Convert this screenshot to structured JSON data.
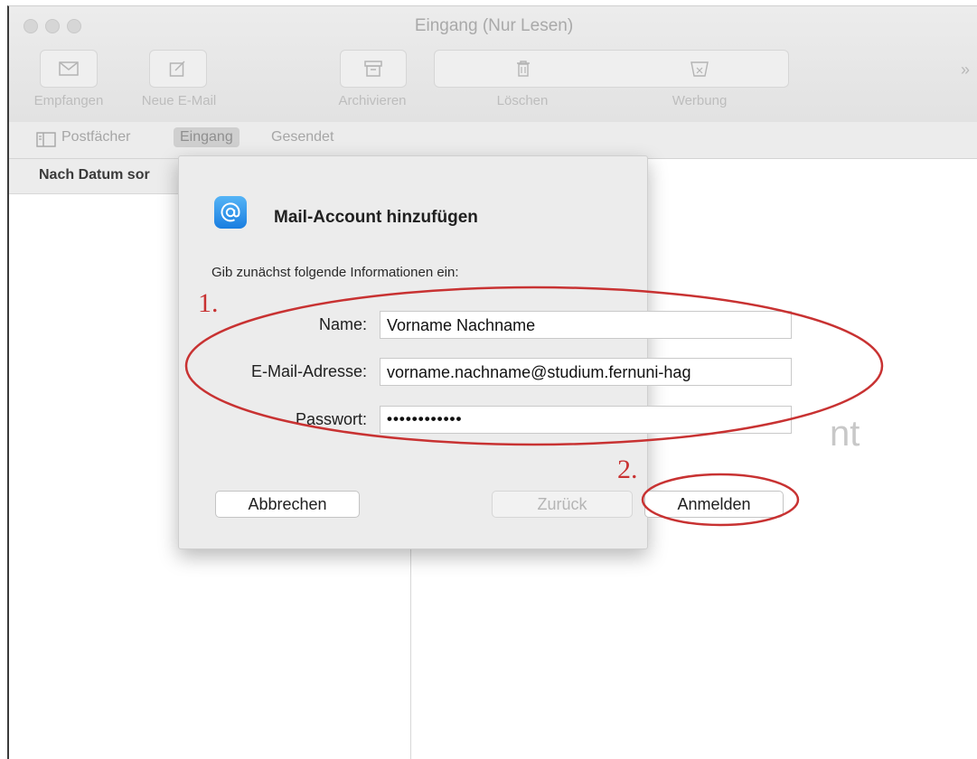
{
  "window": {
    "title": "Eingang (Nur Lesen)"
  },
  "toolbar": {
    "receive_label": "Empfangen",
    "new_mail_label": "Neue E-Mail",
    "archive_label": "Archivieren",
    "delete_label": "Löschen",
    "junk_label": "Werbung",
    "overflow": "»"
  },
  "favorites": {
    "mailboxes": "Postfächer",
    "inbox": "Eingang",
    "sent": "Gesendet"
  },
  "list": {
    "sort_label": "Nach Datum sor"
  },
  "reading": {
    "ghost_text": "nt"
  },
  "dialog": {
    "title": "Mail-Account hinzufügen",
    "subtitle": "Gib zunächst folgende Informationen ein:",
    "name_label": "Name:",
    "name_value": "Vorname Nachname",
    "email_label": "E-Mail-Adresse:",
    "email_value": "vorname.nachname@studium.fernuni-hag",
    "password_label": "Passwort:",
    "password_value": "••••••••••••",
    "cancel_label": "Abbrechen",
    "back_label": "Zurück",
    "login_label": "Anmelden"
  },
  "annotations": {
    "step1": "1.",
    "step2": "2.",
    "color": "#c83232"
  },
  "icons": [
    "envelope-icon",
    "compose-icon",
    "archive-icon",
    "trash-icon",
    "junk-icon",
    "sidebar-icon",
    "at-sign-icon"
  ]
}
